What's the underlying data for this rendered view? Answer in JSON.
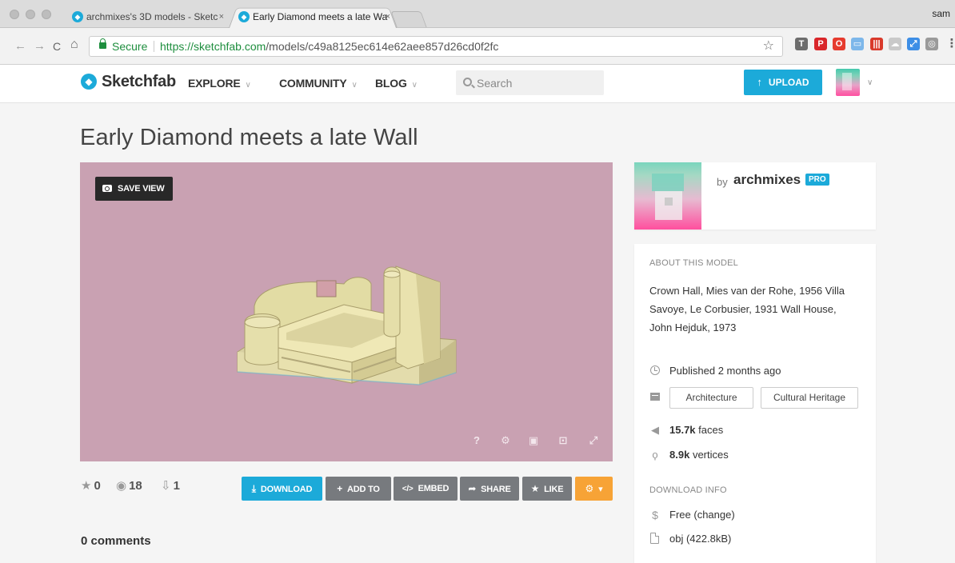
{
  "browser": {
    "tabs": [
      {
        "title": "archmixes's 3D models - Sketc",
        "close": "×"
      },
      {
        "title": "Early Diamond meets a late Wa",
        "close": "×"
      }
    ],
    "profile_name": "sam",
    "secure_label": "Secure",
    "url_host": "https://sketchfab.com",
    "url_path": "/models/c49a8125ec614e62aee857d26cd0f2fc",
    "nav": {
      "back": "←",
      "forward": "→",
      "reload": "C",
      "home": "⌂"
    },
    "bookmark_star": "☆",
    "extensions": [
      {
        "name": "typography-extension-icon",
        "glyph": "T",
        "color": "#6d6d6d"
      },
      {
        "name": "pinterest-extension-icon",
        "glyph": "P",
        "color": "#d9262a"
      },
      {
        "name": "opera-extension-icon",
        "glyph": "O",
        "color": "#e63b2e"
      },
      {
        "name": "docs-extension-icon",
        "glyph": "▭",
        "color": "#7db7ea"
      },
      {
        "name": "bars-extension-icon",
        "glyph": "|||",
        "color": "#d93a2b"
      },
      {
        "name": "cloud-extension-icon",
        "glyph": "☁",
        "color": "#c9c9c9"
      },
      {
        "name": "resize-extension-icon",
        "glyph": "⤢",
        "color": "#3d8ee6"
      },
      {
        "name": "camera-extension-icon",
        "glyph": "◎",
        "color": "#9a9a9a"
      },
      {
        "name": "menu-icon",
        "glyph": "⋮",
        "color": "#666666"
      }
    ]
  },
  "header": {
    "logo_text": "Sketchfab",
    "nav": [
      {
        "label": "EXPLORE"
      },
      {
        "label": "COMMUNITY"
      },
      {
        "label": "BLOG"
      }
    ],
    "search_placeholder": "Search",
    "upload_label": "UPLOAD",
    "upload_icon": "↑",
    "chevron": "∨"
  },
  "model": {
    "title": "Early Diamond meets a late Wall",
    "save_view_label": "SAVE VIEW",
    "viewer_controls": [
      {
        "name": "help-icon",
        "glyph": "?"
      },
      {
        "name": "settings-icon",
        "glyph": "⚙"
      },
      {
        "name": "vr-icon",
        "glyph": "▣"
      },
      {
        "name": "embed-view-icon",
        "glyph": "⊡"
      },
      {
        "name": "fullscreen-icon",
        "glyph": "⤢"
      }
    ],
    "stats": {
      "likes": "0",
      "views": "18",
      "downloads": "1"
    },
    "stat_icons": {
      "likes": "★",
      "views": "◉",
      "downloads": "⇩"
    },
    "actions": {
      "download": "DOWNLOAD",
      "add_to": "ADD TO",
      "embed": "EMBED",
      "share": "SHARE",
      "like": "LIKE",
      "settings_caret": "▾"
    },
    "action_icons": {
      "download": "⤓",
      "add_to": "+",
      "embed": "</>",
      "share": "➦",
      "like": "★",
      "settings": "⚙"
    },
    "comments_label": "0 comments"
  },
  "author": {
    "by": "by",
    "name": "archmixes",
    "badge": "PRO"
  },
  "about": {
    "heading": "ABOUT THIS MODEL",
    "description": "Crown Hall, Mies van der Rohe, 1956 Villa Savoye, Le Corbusier, 1931 Wall House, John Hejduk, 1973",
    "published": "Published 2 months ago",
    "tags": [
      "Architecture",
      "Cultural Heritage"
    ],
    "faces_value": "15.7k",
    "faces_label": "faces",
    "vertices_value": "8.9k",
    "vertices_label": "vertices",
    "faces_icon": "◀",
    "vertices_icon": "ϙ"
  },
  "download_info": {
    "heading": "DOWNLOAD INFO",
    "price": "Free",
    "change_link": "(change)",
    "price_icon": "$",
    "file": "obj (422.8kB)"
  },
  "colors": {
    "accent": "#1caad9",
    "viewer_bg": "#c9a1b2",
    "action_gray": "#777a7e",
    "action_orange": "#f7a336",
    "secure_green": "#1e8e3e"
  }
}
